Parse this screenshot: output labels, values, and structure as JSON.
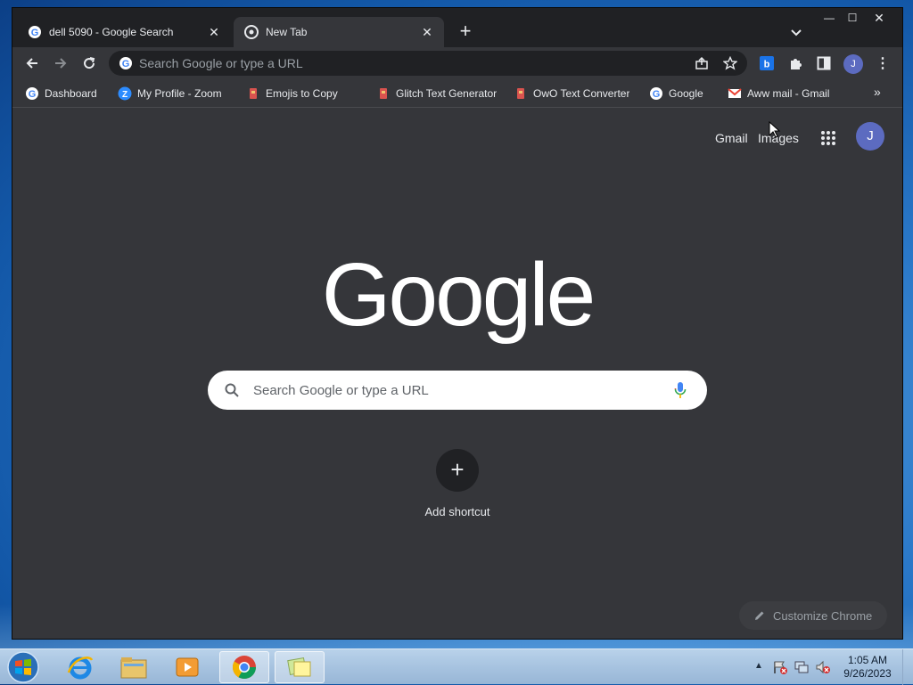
{
  "tabs": [
    {
      "title": "dell 5090 - Google Search",
      "active": false
    },
    {
      "title": "New Tab",
      "active": true
    }
  ],
  "window_controls": {
    "minimize": "—",
    "maximize": "☐",
    "close": "✕"
  },
  "omnibox": {
    "placeholder": "Search Google or type a URL"
  },
  "profile_initial": "J",
  "bookmarks": [
    {
      "label": "Dashboard",
      "icon": "google-icon"
    },
    {
      "label": "My Profile - Zoom",
      "icon": "zoom-icon"
    },
    {
      "label": "Emojis to Copy",
      "icon": "bookmark-icon"
    },
    {
      "label": "Glitch Text Generator",
      "icon": "bookmark-icon"
    },
    {
      "label": "OwO Text Converter",
      "icon": "bookmark-icon"
    },
    {
      "label": "Google",
      "icon": "google-icon"
    },
    {
      "label": "Aww mail - Gmail",
      "icon": "gmail-icon"
    }
  ],
  "ntp": {
    "gmail": "Gmail",
    "images": "Images",
    "logo": "Google",
    "search_placeholder": "Search Google or type a URL",
    "add_shortcut": "Add shortcut",
    "customize": "Customize Chrome"
  },
  "taskbar": {
    "time": "1:05 AM",
    "date": "9/26/2023"
  },
  "colors": {
    "accent": "#5c6bc0",
    "page_bg": "#35363a",
    "frame_bg": "#202124"
  }
}
